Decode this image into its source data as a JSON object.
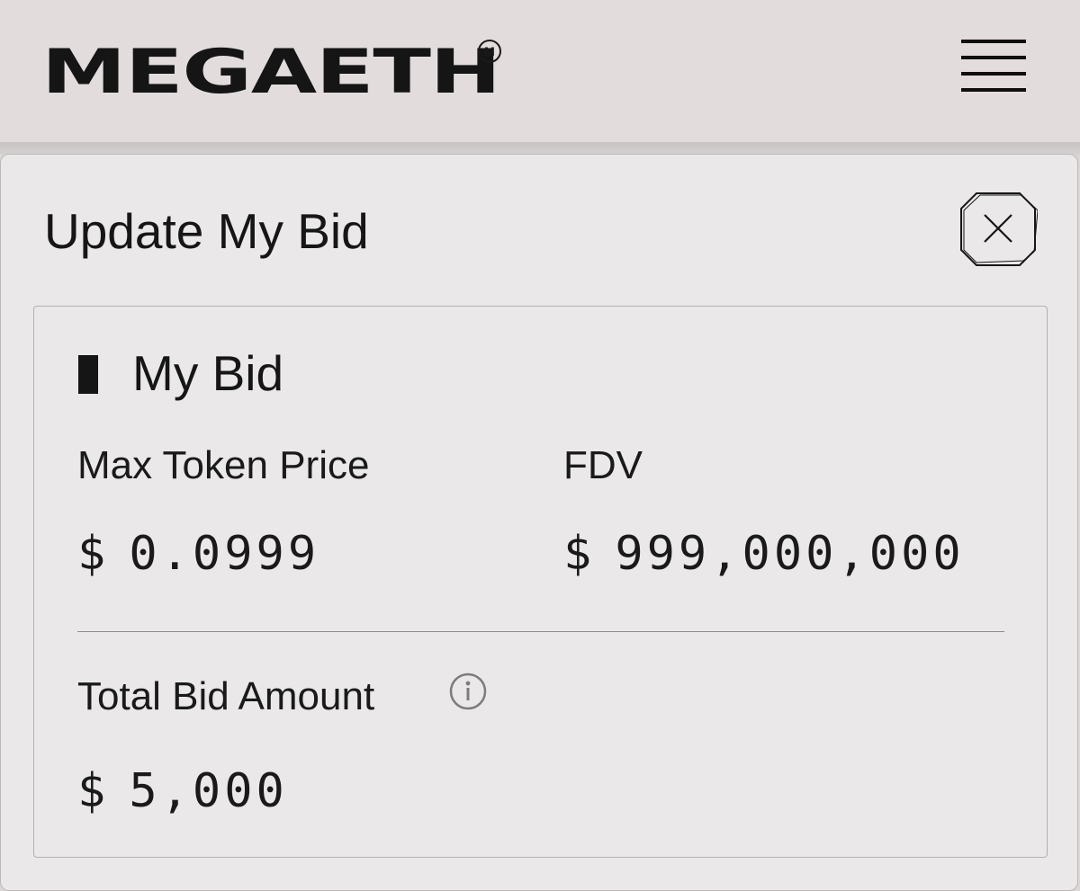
{
  "header": {
    "logo_text": "MEGAETH",
    "logo_mark": "M",
    "menu_icon": "hamburger-menu-icon"
  },
  "modal": {
    "title": "Update My Bid",
    "close_icon": "close-icon"
  },
  "bid_card": {
    "section_title": "My Bid",
    "max_token_price": {
      "label": "Max Token Price",
      "currency": "$",
      "value": "0.0999"
    },
    "fdv": {
      "label": "FDV",
      "currency": "$",
      "value": "999,000,000"
    },
    "total_bid_amount": {
      "label": "Total Bid Amount",
      "info_icon": "info-icon",
      "currency": "$",
      "value": "5,000"
    }
  },
  "colors": {
    "header_bg": "#e2dcdc",
    "modal_bg": "#eae8e8",
    "text": "#161616",
    "border": "#b3b0b0"
  }
}
